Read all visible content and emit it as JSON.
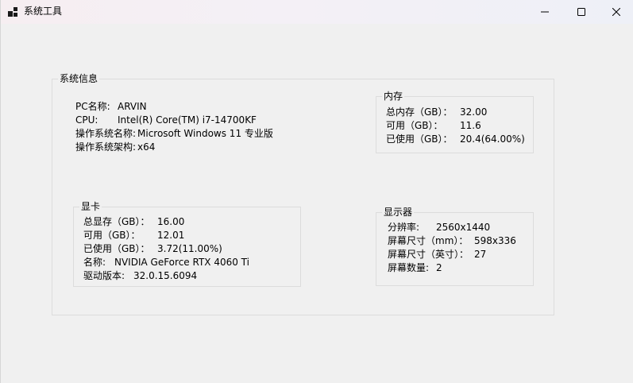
{
  "window": {
    "title": "系统工具"
  },
  "caption_buttons": {
    "minimize": "—",
    "maximize": "☐",
    "close": "✕"
  },
  "system_info": {
    "group_title": "系统信息",
    "rows": [
      {
        "label": "PC名称:",
        "value": "ARVIN"
      },
      {
        "label": "CPU:",
        "value": "Intel(R) Core(TM) i7-14700KF"
      },
      {
        "label": "操作系统名称:",
        "value": "Microsoft Windows 11 专业版"
      },
      {
        "label": "操作系统架构:",
        "value": "x64"
      }
    ]
  },
  "memory": {
    "group_title": "内存",
    "rows": [
      {
        "label": "总内存（GB）：",
        "value": "32.00"
      },
      {
        "label": "可用（GB）：",
        "value": "11.6"
      },
      {
        "label": "已使用（GB）：",
        "value": "20.4(64.00%)"
      }
    ]
  },
  "gpu": {
    "group_title": "显卡",
    "rows": [
      {
        "label": "总显存（GB）：",
        "value": "16.00"
      },
      {
        "label": "可用（GB）：",
        "value": "12.01"
      },
      {
        "label": "已使用（GB）：",
        "value": "3.72(11.00%)"
      },
      {
        "label": "名称:",
        "value": "NVIDIA GeForce RTX 4060 Ti"
      },
      {
        "label": "驱动版本:",
        "value": "32.0.15.6094"
      }
    ]
  },
  "display": {
    "group_title": "显示器",
    "rows": [
      {
        "label": "分辨率:",
        "value": "2560x1440"
      },
      {
        "label": "屏幕尺寸（mm）：",
        "value": "598x336"
      },
      {
        "label": "屏幕尺寸（英寸）：",
        "value": "27"
      },
      {
        "label": "屏幕数量:",
        "value": "2"
      }
    ]
  }
}
